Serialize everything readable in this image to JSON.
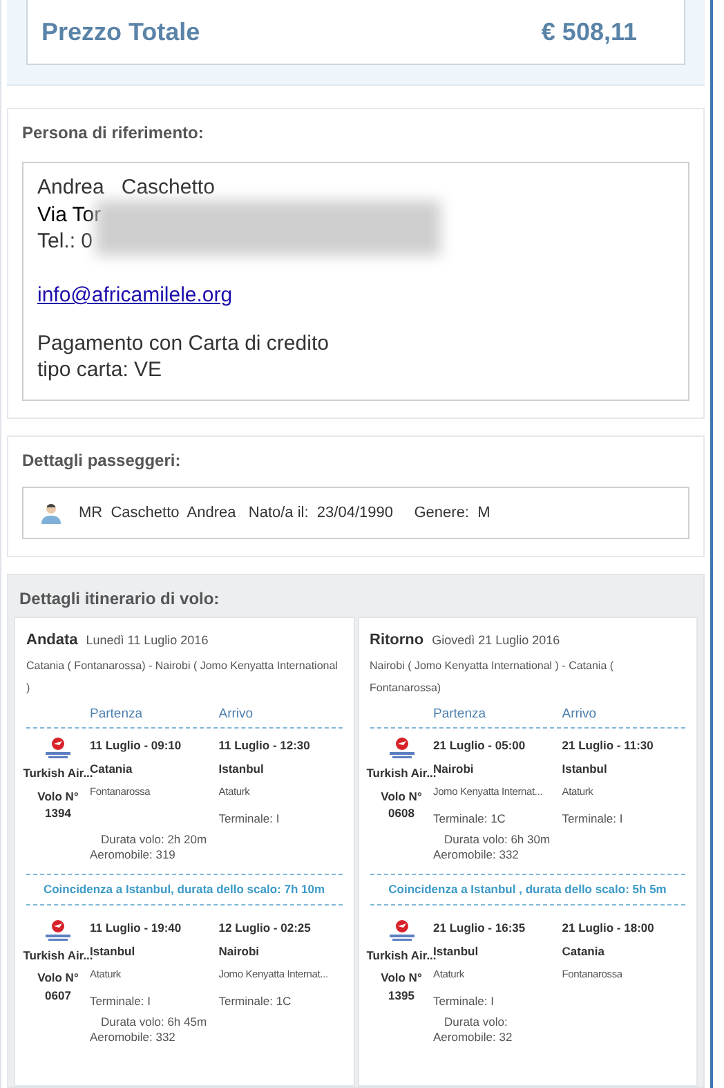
{
  "total": {
    "label": "Prezzo Totale",
    "amount": "€ 508,11"
  },
  "contact": {
    "title": "Persona di riferimento:",
    "name": "Andrea   Caschetto",
    "address": "Via Tor",
    "phone": "Tel.: 0",
    "email": "info@africamilele.org",
    "payment": "Pagamento con Carta di credito",
    "card_type": "tipo carta: VE"
  },
  "passengers": {
    "title": "Dettagli passeggeri:",
    "items": [
      {
        "title": "MR",
        "surname": "Caschetto",
        "name": "Andrea",
        "birth_label": "Nato/a il:",
        "birth": "23/04/1990",
        "gender_label": "Genere:",
        "gender": "M"
      }
    ]
  },
  "itinerary": {
    "title": "Dettagli itinerario di volo:",
    "legs": [
      {
        "label": "Andata",
        "date": "Lunedì 11 Luglio 2016",
        "route": "Catania ( Fontanarossa) - Nairobi ( Jomo Kenyatta International )",
        "dep_header": "Partenza",
        "arr_header": "Arrivo",
        "items": [
          {
            "kind": "segment",
            "airline": "Turkish Air...",
            "flight_label": "Volo N°",
            "flight_number": "1394",
            "departure": {
              "datetime": "11 Luglio - 09:10",
              "city": "Catania",
              "airport": "Fontanarossa"
            },
            "arrival": {
              "datetime": "11 Luglio - 12:30",
              "city": "Istanbul",
              "airport": "Ataturk",
              "terminal": "Terminale:  I"
            },
            "duration": "Durata volo: 2h 20m",
            "aircraft": "Aeromobile: 319"
          },
          {
            "kind": "connection",
            "text": "Coincidenza a Istanbul, durata dello scalo: 7h 10m"
          },
          {
            "kind": "segment",
            "airline": "Turkish Air...",
            "flight_label": "Volo N°",
            "flight_number": "0607",
            "departure": {
              "datetime": "11 Luglio - 19:40",
              "city": "Istanbul",
              "airport": "Ataturk",
              "terminal": "Terminale:  I"
            },
            "arrival": {
              "datetime": "12 Luglio - 02:25",
              "city": "Nairobi",
              "airport": "Jomo Kenyatta Internat...",
              "terminal": "Terminale:  1C"
            },
            "duration": "Durata volo: 6h 45m",
            "aircraft": "Aeromobile: 332"
          }
        ]
      },
      {
        "label": "Ritorno",
        "date": "Giovedì 21 Luglio 2016",
        "route": "Nairobi ( Jomo Kenyatta International ) - Catania ( Fontanarossa)",
        "dep_header": "Partenza",
        "arr_header": "Arrivo",
        "items": [
          {
            "kind": "segment",
            "airline": "Turkish Air...",
            "flight_label": "Volo N°",
            "flight_number": "0608",
            "departure": {
              "datetime": "21 Luglio - 05:00",
              "city": "Nairobi",
              "airport": "Jomo Kenyatta Internat...",
              "terminal": "Terminale:  1C"
            },
            "arrival": {
              "datetime": "21 Luglio - 11:30",
              "city": "Istanbul",
              "airport": "Ataturk",
              "terminal": "Terminale:  I"
            },
            "duration": "Durata volo: 6h 30m",
            "aircraft": "Aeromobile: 332"
          },
          {
            "kind": "connection",
            "text": "Coincidenza a Istanbul , durata dello scalo: 5h 5m"
          },
          {
            "kind": "segment",
            "airline": "Turkish Air...",
            "flight_label": "Volo N°",
            "flight_number": "1395",
            "departure": {
              "datetime": "21 Luglio - 16:35",
              "city": "Istanbul",
              "airport": "Ataturk",
              "terminal": "Terminale:  I"
            },
            "arrival": {
              "datetime": "21 Luglio - 18:00",
              "city": "Catania",
              "airport": "Fontanarossa"
            },
            "duration": "Durata volo:",
            "aircraft": "Aeromobile: 32"
          }
        ]
      }
    ]
  }
}
